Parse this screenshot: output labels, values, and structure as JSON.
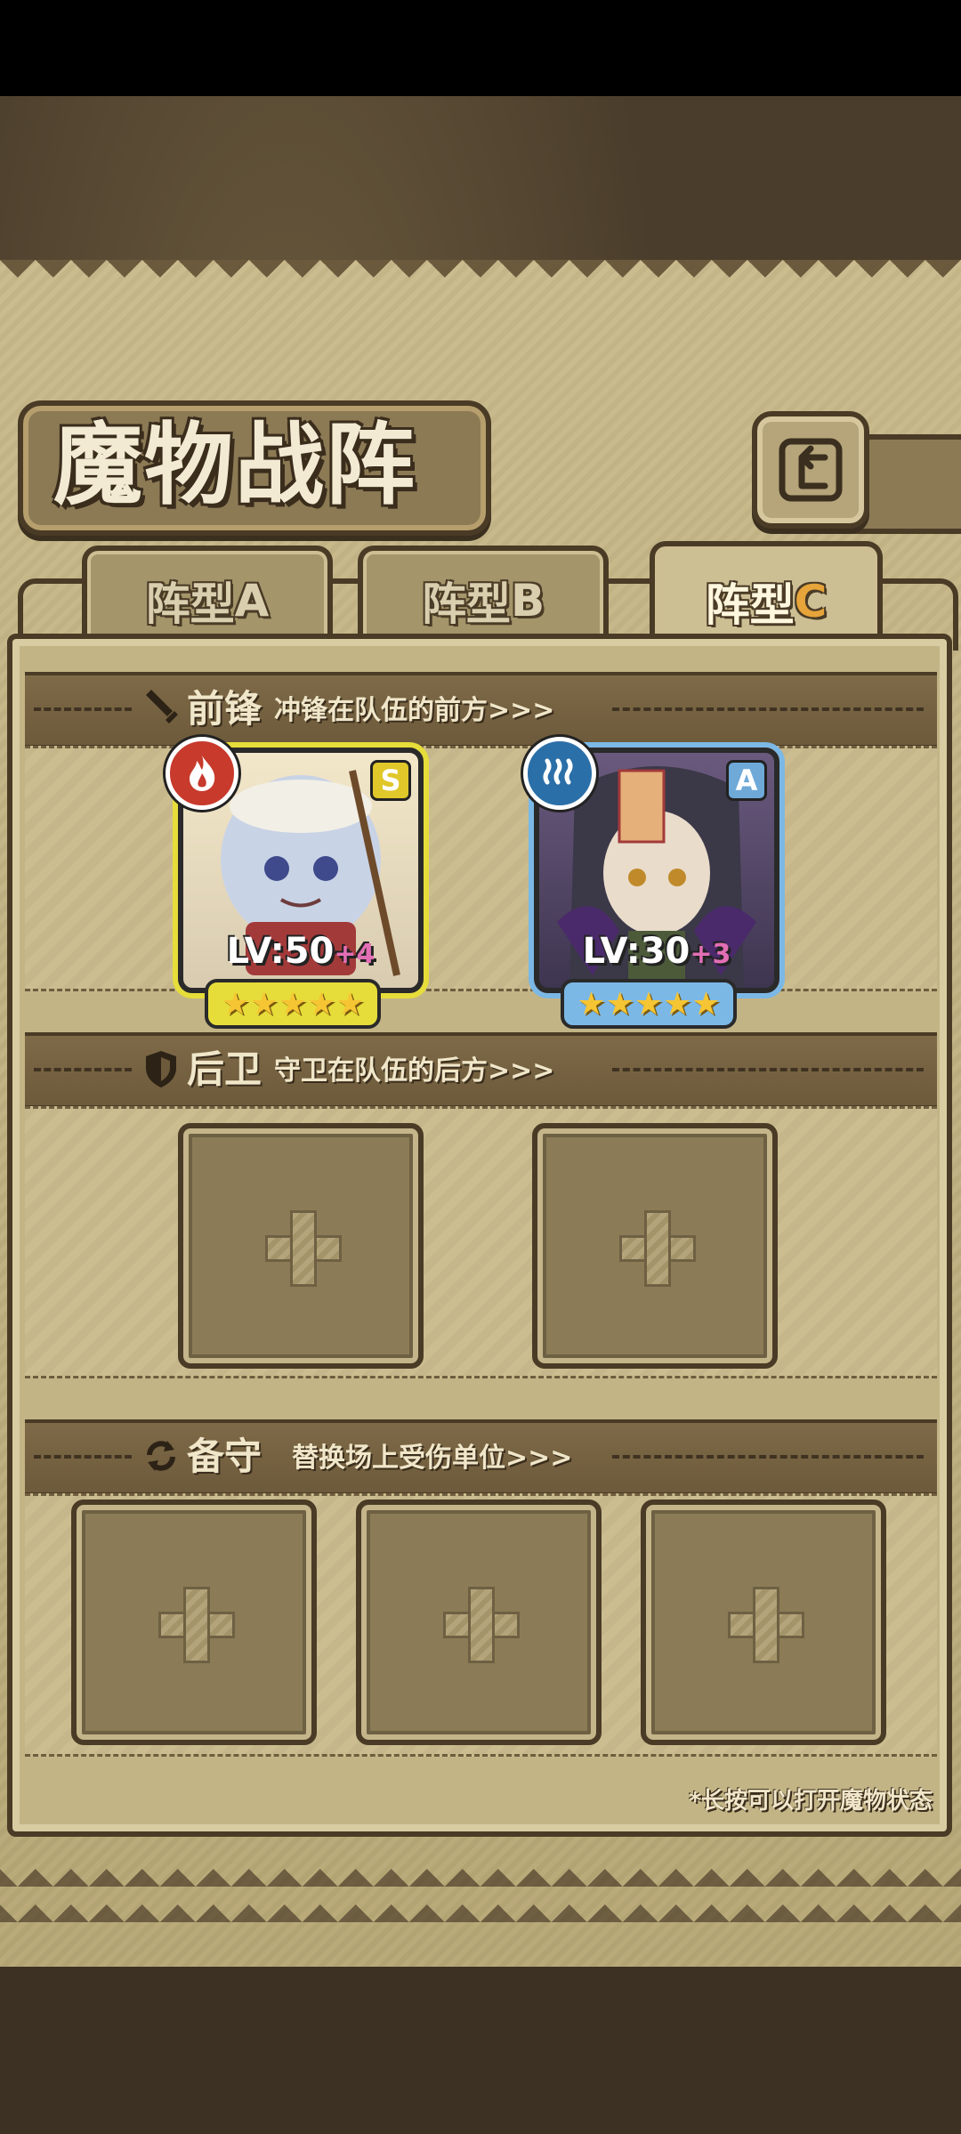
{
  "screen_title": "魔物战阵",
  "tabs": [
    {
      "prefix": "阵型",
      "letter": "A",
      "selected": false
    },
    {
      "prefix": "阵型",
      "letter": "B",
      "selected": false
    },
    {
      "prefix": "阵型",
      "letter": "C",
      "selected": true
    }
  ],
  "sections": {
    "vanguard": {
      "title": "前锋",
      "subtitle": "冲锋在队伍的前方>>>",
      "icon": "sword-icon"
    },
    "rearguard": {
      "title": "后卫",
      "subtitle": "守卫在队伍的后方>>>",
      "icon": "shield-icon"
    },
    "reserve": {
      "title": "备守",
      "subtitle": "替换场上受伤单位>>>",
      "icon": "swap-icon"
    }
  },
  "vanguard_units": [
    {
      "rank": "S",
      "element": "fire",
      "level_label": "LV:",
      "level": "50",
      "bonus": "+4",
      "stars": 5,
      "frame_color": "#e6dd3a"
    },
    {
      "rank": "A",
      "element": "water",
      "level_label": "LV:",
      "level": "30",
      "bonus": "+3",
      "stars": 5,
      "frame_color": "#7cb8e6"
    }
  ],
  "rearguard_slots": 2,
  "reserve_slots": 3,
  "hint": "*长按可以打开魔物状态",
  "star_glyph": "★★★★★",
  "colors": {
    "panel": "#c3b486",
    "border": "#4a3b26",
    "accent_tab": "#e6a43a"
  }
}
